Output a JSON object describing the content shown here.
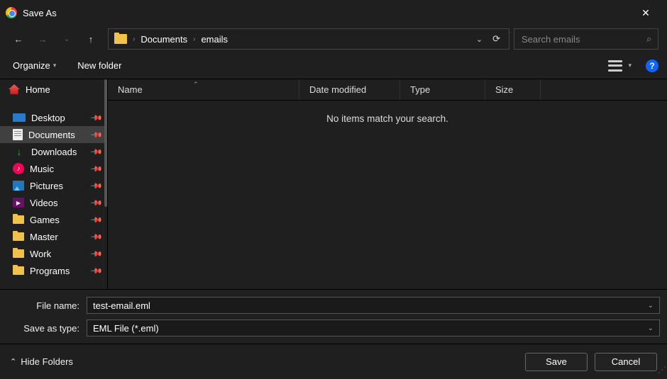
{
  "window": {
    "title": "Save As"
  },
  "breadcrumb": {
    "items": [
      "Documents",
      "emails"
    ]
  },
  "search": {
    "placeholder": "Search emails"
  },
  "toolbar": {
    "organize": "Organize",
    "newfolder": "New folder"
  },
  "sidebar": {
    "home": "Home",
    "items": [
      {
        "label": "Desktop"
      },
      {
        "label": "Documents"
      },
      {
        "label": "Downloads"
      },
      {
        "label": "Music"
      },
      {
        "label": "Pictures"
      },
      {
        "label": "Videos"
      },
      {
        "label": "Games"
      },
      {
        "label": "Master"
      },
      {
        "label": "Work"
      },
      {
        "label": "Programs"
      }
    ]
  },
  "columns": {
    "name": "Name",
    "date": "Date modified",
    "type": "Type",
    "size": "Size"
  },
  "content": {
    "empty": "No items match your search."
  },
  "fields": {
    "filename_label": "File name:",
    "filename_value": "test-email.eml",
    "type_label": "Save as type:",
    "type_value": "EML File (*.eml)"
  },
  "footer": {
    "hide": "Hide Folders",
    "save": "Save",
    "cancel": "Cancel"
  }
}
